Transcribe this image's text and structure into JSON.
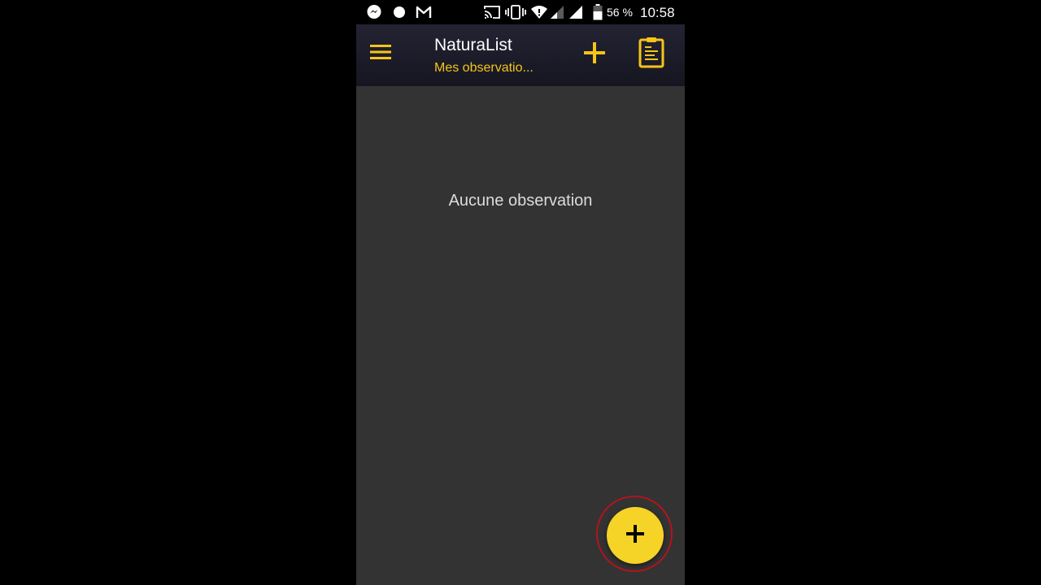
{
  "status_bar": {
    "battery_percent": "56 %",
    "time": "10:58",
    "icons": [
      "messenger-icon",
      "notification-dot-icon",
      "gmail-icon",
      "cast-icon",
      "vibrate-icon",
      "wifi-icon",
      "signal-icon",
      "signal-icon",
      "battery-icon"
    ]
  },
  "app_bar": {
    "title": "NaturaList",
    "subtitle": "Mes observatio...",
    "icons": [
      "menu-icon",
      "plus-icon",
      "clipboard-icon"
    ]
  },
  "main": {
    "empty_message": "Aucune observation"
  },
  "fab": {
    "icon": "plus-icon"
  },
  "colors": {
    "accent": "#f5c518",
    "fab": "#f5d327",
    "background": "#333333",
    "app_bar": "#1c1c28",
    "highlight_ring": "#b3141e"
  }
}
